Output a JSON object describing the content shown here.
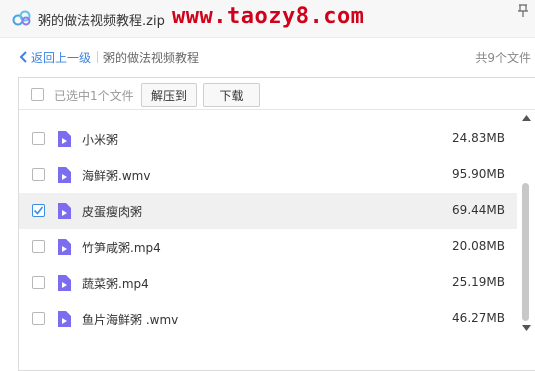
{
  "window": {
    "title": "粥的做法视频教程.zip",
    "watermark": "www.taozy8.com"
  },
  "nav": {
    "back_label": "返回上一级",
    "current_folder": "粥的做法视频教程",
    "file_count": "共9个文件"
  },
  "toolbar": {
    "selection_label": "已选中1个文件",
    "extract_label": "解压到",
    "download_label": "下载"
  },
  "files": [
    {
      "name": "小米粥",
      "size": "24.83MB",
      "checked": false
    },
    {
      "name": "海鲜粥.wmv",
      "size": "95.90MB",
      "checked": false
    },
    {
      "name": "皮蛋瘦肉粥",
      "size": "69.44MB",
      "checked": true
    },
    {
      "name": "竹笋咸粥.mp4",
      "size": "20.08MB",
      "checked": false
    },
    {
      "name": "蔬菜粥.mp4",
      "size": "25.19MB",
      "checked": false
    },
    {
      "name": "鱼片海鲜粥  .wmv",
      "size": "46.27MB",
      "checked": false
    }
  ],
  "icons": {
    "app": "cloud-logo-icon",
    "file": "video-file-icon",
    "back": "chevron-left-icon",
    "pin": "pin-icon"
  },
  "colors": {
    "accent": "#3c84e0",
    "watermark": "#d0021b",
    "file_icon": "#7b6cf0",
    "selected_row": "#f0f0f0",
    "checkbox_check": "#3a8ee6"
  }
}
